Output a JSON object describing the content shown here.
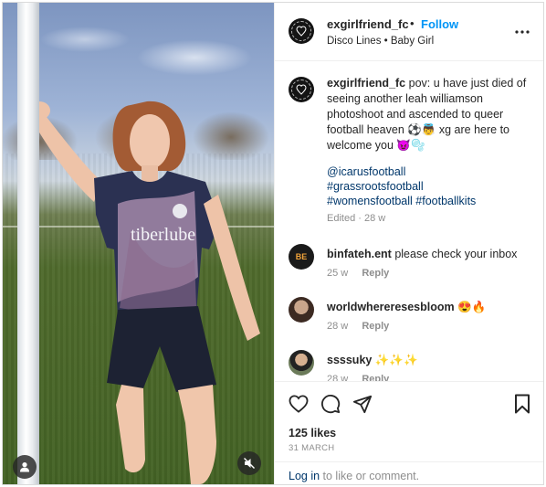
{
  "header": {
    "username": "exgirlfriend_fc",
    "separator": "•",
    "follow_label": "Follow",
    "audio": "Disco Lines • Baby Girl",
    "more_icon": "more-horizontal-icon"
  },
  "caption": {
    "username": "exgirlfriend_fc",
    "text": "pov: u have just died of seeing another leah williamson photoshoot and ascended to queer football heaven ⚽👼 xg are here to welcome you 😈🫧",
    "tags": [
      "@icarusfootball",
      "#grassrootsfootball",
      "#womensfootball #footballkits"
    ],
    "meta": "Edited · 28 w"
  },
  "comments": [
    {
      "username": "binfateh.ent",
      "text": "please check your inbox",
      "time": "25 w",
      "reply": "Reply",
      "avatar_text": "BE"
    },
    {
      "username": "worldwhereresesbloom",
      "text": "😍🔥",
      "time": "28 w",
      "reply": "Reply",
      "avatar_text": ""
    },
    {
      "username": "ssssuky",
      "text": "✨✨✨",
      "time": "28 w",
      "reply": "Reply",
      "avatar_text": ""
    }
  ],
  "actions": {
    "likes": "125 likes",
    "date": "31 MARCH"
  },
  "login": {
    "link": "Log in",
    "rest": " to like or comment."
  },
  "photo": {
    "shirt_text": "tiberlube"
  },
  "colors": {
    "link_blue": "#0095f6",
    "hashtag": "#00376b",
    "muted": "#8e8e8e",
    "text": "#262626"
  }
}
